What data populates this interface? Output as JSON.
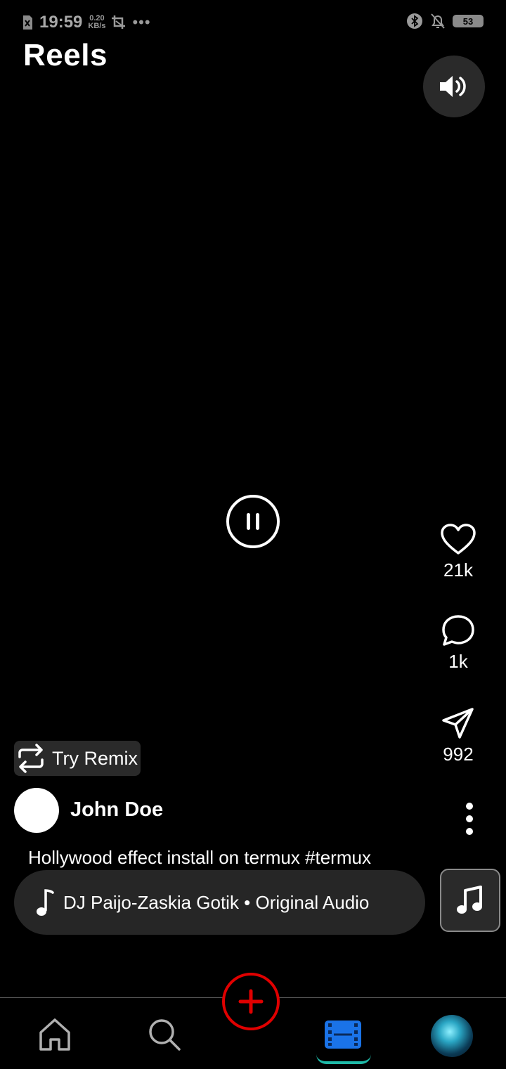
{
  "status_bar": {
    "time": "19:59",
    "speed_value": "0.20",
    "speed_unit": "KB/s",
    "overflow": "•••",
    "battery": "53"
  },
  "header": {
    "title": "Reels"
  },
  "actions": {
    "likes": "21k",
    "comments": "1k",
    "shares": "992"
  },
  "remix": {
    "label": "Try Remix"
  },
  "post": {
    "username": "John Doe",
    "caption": "Hollywood effect install on termux #termux",
    "audio": "DJ Paijo-Zaskia Gotik • Original Audio"
  },
  "colors": {
    "accent_active": "#1a73e8",
    "create_red": "#e00000",
    "underline": "#1fb9a8"
  },
  "nav": {
    "items": [
      "home-icon",
      "search-icon",
      "create-icon",
      "reels-icon",
      "profile-avatar"
    ],
    "active": "reels"
  }
}
